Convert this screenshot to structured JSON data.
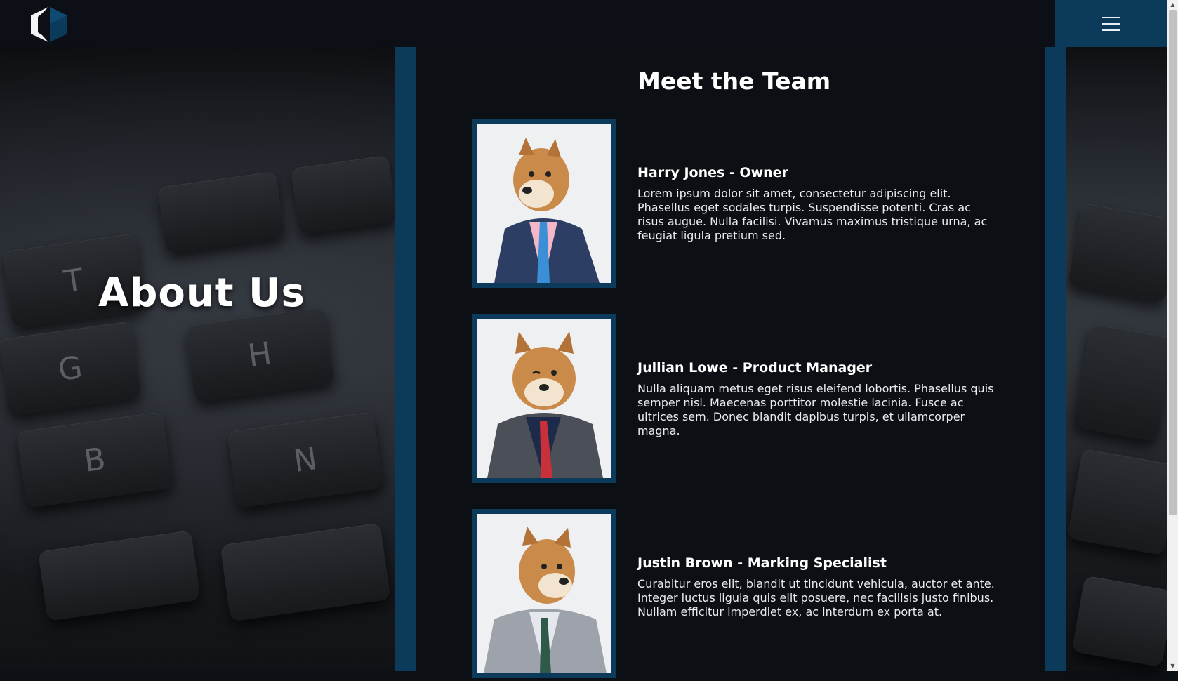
{
  "header": {
    "logo_icon": "hexagon-logo-icon",
    "menu_icon": "hamburger-menu-icon"
  },
  "hero": {
    "title": "About Us",
    "background_keys": [
      "T",
      "G",
      "H",
      "B",
      "N"
    ]
  },
  "team": {
    "heading": "Meet the Team",
    "members": [
      {
        "name": "Harry Jones - Owner",
        "bio": "Lorem ipsum dolor sit amet, consectetur adipiscing elit. Phasellus eget sodales turpis. Suspendisse potenti. Cras ac risus augue. Nulla facilisi. Vivamus maximus tristique urna, ac feugiat ligula pretium sed.",
        "tie_color": "#3b8fd6",
        "shirt_color": "#f4b7c8",
        "jacket_color": "#2c3e63"
      },
      {
        "name": "Jullian Lowe - Product Manager",
        "bio": "Nulla aliquam metus eget risus eleifend lobortis. Phasellus quis semper nisl. Maecenas porttitor molestie lacinia. Fusce ac ultrices sem. Donec blandit dapibus turpis, et ullamcorper magna.",
        "tie_color": "#c9303a",
        "shirt_color": "#1d2a4a",
        "jacket_color": "#4a4f58"
      },
      {
        "name": "Justin Brown - Marking Specialist",
        "bio": "Curabitur eros elit, blandit ut tincidunt vehicula, auctor et ante. Integer luctus ligula quis elit posuere, nec facilisis justo finibus. Nullam efficitur imperdiet ex, ac interdum ex porta at.",
        "tie_color": "#2f5a4a",
        "shirt_color": "#e4e8ee",
        "jacket_color": "#9ea3ab"
      }
    ]
  },
  "colors": {
    "accent": "#0b3a5a",
    "page_background": "#0c0f14"
  }
}
